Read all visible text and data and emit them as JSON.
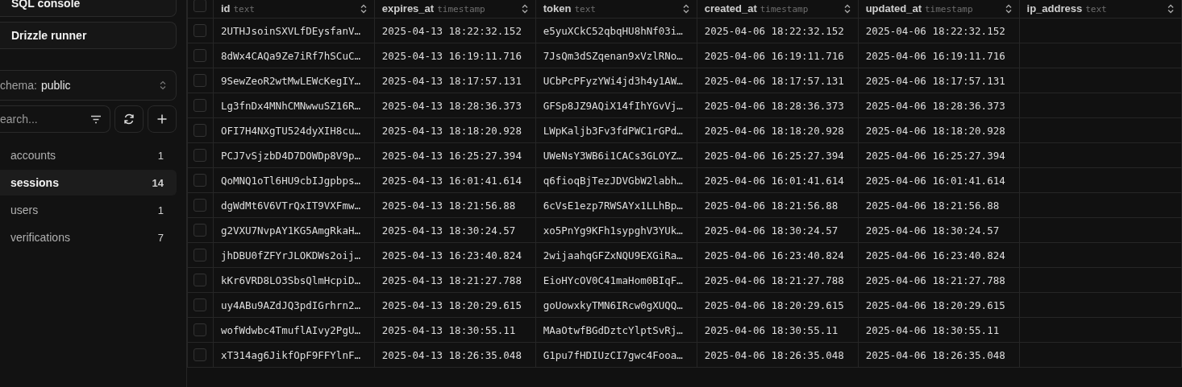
{
  "sidebar": {
    "buttons": [
      {
        "label": "SQL console"
      },
      {
        "label": "Drizzle runner"
      }
    ],
    "schema": {
      "label": "chema:",
      "value": "public"
    },
    "search": {
      "placeholder": "earch..."
    },
    "tables": [
      {
        "name": "accounts",
        "count": "1",
        "selected": false
      },
      {
        "name": "sessions",
        "count": "14",
        "selected": true
      },
      {
        "name": "users",
        "count": "1",
        "selected": false
      },
      {
        "name": "verifications",
        "count": "7",
        "selected": false
      }
    ]
  },
  "table": {
    "all_checked": false,
    "columns": [
      {
        "name": "id",
        "type": "text"
      },
      {
        "name": "expires_at",
        "type": "timestamp"
      },
      {
        "name": "token",
        "type": "text"
      },
      {
        "name": "created_at",
        "type": "timestamp"
      },
      {
        "name": "updated_at",
        "type": "timestamp"
      },
      {
        "name": "ip_address",
        "type": "text"
      }
    ],
    "rows": [
      {
        "checked": false,
        "cells": [
          "2UTHJsoinSXVLfDEysfanV…",
          "2025-04-13 18:22:32.152",
          "e5yuXCkC52qbqHU8hNf03i…",
          "2025-04-06 18:22:32.152",
          "2025-04-06 18:22:32.152"
        ]
      },
      {
        "checked": false,
        "cells": [
          "8dWx4CAQa9Ze7iRf7hSCuC…",
          "2025-04-13 16:19:11.716",
          "7JsQm3dSZqenan9xVzlRNo…",
          "2025-04-06 16:19:11.716",
          "2025-04-06 16:19:11.716"
        ]
      },
      {
        "checked": false,
        "cells": [
          "9SewZeoR2wtMwLEWcKegIY…",
          "2025-04-13 18:17:57.131",
          "UCbPcPFyzYWi4jd3h4y1AW…",
          "2025-04-06 18:17:57.131",
          "2025-04-06 18:17:57.131"
        ]
      },
      {
        "checked": false,
        "cells": [
          "Lg3fnDx4MNhCMNwwuSZ16R…",
          "2025-04-13 18:28:36.373",
          "GFSp8JZ9AQiX14fIhYGvVj…",
          "2025-04-06 18:28:36.373",
          "2025-04-06 18:28:36.373"
        ]
      },
      {
        "checked": false,
        "cells": [
          "OFI7H4NXgTU524dyXIH8cu…",
          "2025-04-13 18:18:20.928",
          "LWpKaljb3Fv3fdPWC1rGPd…",
          "2025-04-06 18:18:20.928",
          "2025-04-06 18:18:20.928"
        ]
      },
      {
        "checked": false,
        "cells": [
          "PCJ7vSjzbD4D7DOWDp8V9p…",
          "2025-04-13 16:25:27.394",
          "UWeNsY3WB6i1CACs3GLOYZ…",
          "2025-04-06 16:25:27.394",
          "2025-04-06 16:25:27.394"
        ]
      },
      {
        "checked": false,
        "cells": [
          "QoMNQ1oTl6HU9cbIJgpbps…",
          "2025-04-13 16:01:41.614",
          "q6fioqBjTezJDVGbW2labh…",
          "2025-04-06 16:01:41.614",
          "2025-04-06 16:01:41.614"
        ]
      },
      {
        "checked": false,
        "cells": [
          "dgWdMt6V6VTrQxIT9VXFmw…",
          "2025-04-13 18:21:56.88",
          "6cVsE1ezp7RWSAYx1LLhBp…",
          "2025-04-06 18:21:56.88",
          "2025-04-06 18:21:56.88"
        ]
      },
      {
        "checked": false,
        "cells": [
          "g2VXU7NvpAY1KG5AmgRkaH…",
          "2025-04-13 18:30:24.57",
          "xo5PnYg9KFh1sypghV3YUk…",
          "2025-04-06 18:30:24.57",
          "2025-04-06 18:30:24.57"
        ]
      },
      {
        "checked": false,
        "cells": [
          "jhDBU0fZFYrJLOKDWs2oij…",
          "2025-04-13 16:23:40.824",
          "2wijaahqGFZxNQU9EXGiRa…",
          "2025-04-06 16:23:40.824",
          "2025-04-06 16:23:40.824"
        ]
      },
      {
        "checked": false,
        "cells": [
          "kKr6VRD8LO3SbsQlmHcpiD…",
          "2025-04-13 18:21:27.788",
          "EioHYcOV0C41maHom0BIqF…",
          "2025-04-06 18:21:27.788",
          "2025-04-06 18:21:27.788"
        ]
      },
      {
        "checked": false,
        "cells": [
          "uy4ABu9AZdJQ3pdIGrhrn2…",
          "2025-04-13 18:20:29.615",
          "goUowxkyTMN6IRcw0gXUQQ…",
          "2025-04-06 18:20:29.615",
          "2025-04-06 18:20:29.615"
        ]
      },
      {
        "checked": false,
        "cells": [
          "wofWdwbc4TmuflAIvy2PgU…",
          "2025-04-13 18:30:55.11",
          "MAaOtwfBGdDztcYlptSvRj…",
          "2025-04-06 18:30:55.11",
          "2025-04-06 18:30:55.11"
        ]
      },
      {
        "checked": false,
        "cells": [
          "xT314ag6JikfOpF9FFYlnF…",
          "2025-04-13 18:26:35.048",
          "G1pu7fHDIUzCI7gwc4Fooa…",
          "2025-04-06 18:26:35.048",
          "2025-04-06 18:26:35.048"
        ]
      }
    ]
  }
}
